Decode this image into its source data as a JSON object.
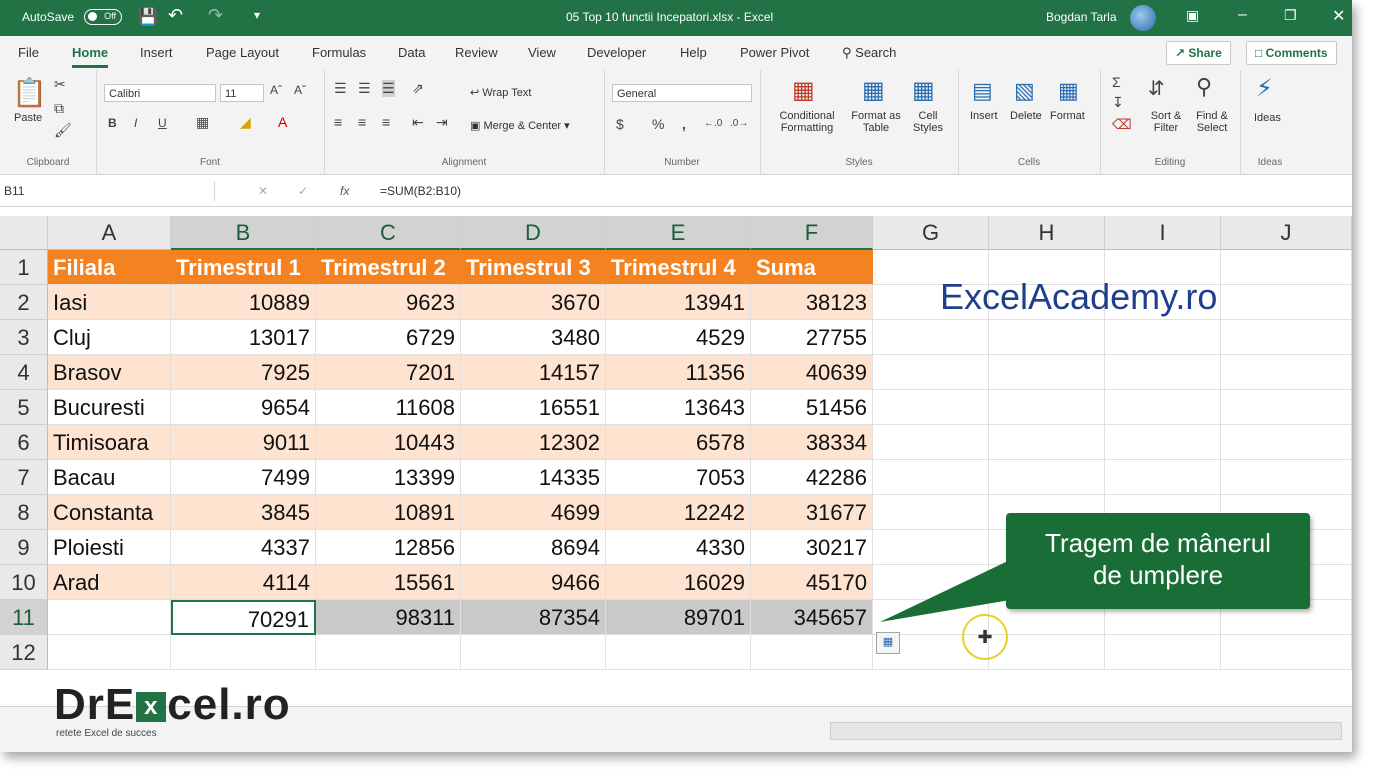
{
  "titlebar": {
    "autosave": "AutoSave",
    "autosave_state": "Off",
    "filename": "05 Top 10 functii Incepatori.xlsx  -  Excel",
    "user": "Bogdan Tarla"
  },
  "tabs": [
    "File",
    "Home",
    "Insert",
    "Page Layout",
    "Formulas",
    "Data",
    "Review",
    "View",
    "Developer",
    "Help",
    "Power Pivot"
  ],
  "search_label": "Search",
  "share_label": "Share",
  "comments_label": "Comments",
  "ribbon": {
    "clipboard": {
      "paste": "Paste",
      "label": "Clipboard"
    },
    "font": {
      "name": "Calibri",
      "size": "11",
      "label": "Font"
    },
    "alignment": {
      "wrap": "Wrap Text",
      "merge": "Merge & Center",
      "label": "Alignment"
    },
    "number": {
      "format": "General",
      "label": "Number"
    },
    "styles": {
      "cond1": "Conditional",
      "cond2": "Formatting",
      "table1": "Format as",
      "table2": "Table",
      "cell1": "Cell",
      "cell2": "Styles",
      "label": "Styles"
    },
    "cells": {
      "insert": "Insert",
      "delete": "Delete",
      "format": "Format",
      "label": "Cells"
    },
    "editing": {
      "sort1": "Sort &",
      "sort2": "Filter",
      "find1": "Find &",
      "find2": "Select",
      "label": "Editing"
    },
    "ideas": {
      "btn": "Ideas",
      "label": "Ideas"
    }
  },
  "formula_bar": {
    "name_box": "B11",
    "fx": "fx",
    "formula": "=SUM(B2:B10)"
  },
  "columns": [
    "A",
    "B",
    "C",
    "D",
    "E",
    "F",
    "G",
    "H",
    "I",
    "J"
  ],
  "rows": [
    "1",
    "2",
    "3",
    "4",
    "5",
    "6",
    "7",
    "8",
    "9",
    "10",
    "11",
    "12"
  ],
  "table": {
    "headers": [
      "Filiala",
      "Trimestrul 1",
      "Trimestrul 2",
      "Trimestrul 3",
      "Trimestrul 4",
      "Suma"
    ],
    "data": [
      [
        "Iasi",
        "10889",
        "9623",
        "3670",
        "13941",
        "38123"
      ],
      [
        "Cluj",
        "13017",
        "6729",
        "3480",
        "4529",
        "27755"
      ],
      [
        "Brasov",
        "7925",
        "7201",
        "14157",
        "11356",
        "40639"
      ],
      [
        "Bucuresti",
        "9654",
        "11608",
        "16551",
        "13643",
        "51456"
      ],
      [
        "Timisoara",
        "9011",
        "10443",
        "12302",
        "6578",
        "38334"
      ],
      [
        "Bacau",
        "7499",
        "13399",
        "14335",
        "7053",
        "42286"
      ],
      [
        "Constanta",
        "3845",
        "10891",
        "4699",
        "12242",
        "31677"
      ],
      [
        "Ploiesti",
        "4337",
        "12856",
        "8694",
        "4330",
        "30217"
      ],
      [
        "Arad",
        "4114",
        "15561",
        "9466",
        "16029",
        "45170"
      ]
    ],
    "totals": [
      "",
      "70291",
      "98311",
      "87354",
      "89701",
      "345657"
    ]
  },
  "brand_text": "ExcelAcademy.ro",
  "callout": {
    "line1": "Tragem de mânerul",
    "line2": "de umplere"
  },
  "logo": {
    "pre": "DrE",
    "x": "x",
    "post": "cel.ro",
    "tagline": "retete Excel de succes"
  },
  "colors": {
    "excel_green": "#217346",
    "header_orange": "#f58220",
    "band_peach": "#fde3d0",
    "total_gray": "#c9c9c9",
    "brand_blue": "#1f3f8c",
    "callout_green": "#196d36"
  }
}
